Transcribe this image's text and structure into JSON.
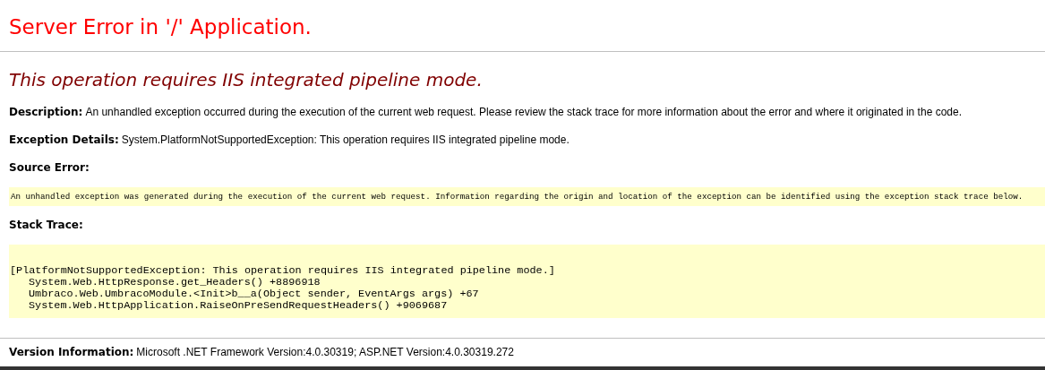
{
  "title": "Server Error in '/' Application.",
  "heading": "This operation requires IIS integrated pipeline mode.",
  "fields": [
    {
      "label": "Description:",
      "text": "An unhandled exception occurred during the execution of the current web request. Please review the stack trace for more information about the error and where it originated in the code."
    },
    {
      "label": "Exception Details:",
      "text": "System.PlatformNotSupportedException: This operation requires IIS integrated pipeline mode."
    }
  ],
  "source_error": {
    "label": "Source Error:",
    "text": "An unhandled exception was generated during the execution of the current web request. Information regarding the origin and location of the exception can be identified using the exception stack trace below."
  },
  "stack_trace": {
    "label": "Stack Trace:",
    "lines": [
      {
        "text": "[PlatformNotSupportedException: This operation requires IIS integrated pipeline mode.]",
        "children": [
          {
            "text": "System.Web.HttpResponse.get_Headers() +8896918"
          },
          {
            "text": "Umbraco.Web.UmbracoModule.<Init>b__a(Object sender, EventArgs args) +67"
          },
          {
            "text": "System.Web.HttpApplication.RaiseOnPreSendRequestHeaders() +9069687"
          }
        ]
      }
    ]
  },
  "version": {
    "label": "Version Information:",
    "text": "Microsoft .NET Framework Version:4.0.30319; ASP.NET Version:4.0.30319.272"
  }
}
